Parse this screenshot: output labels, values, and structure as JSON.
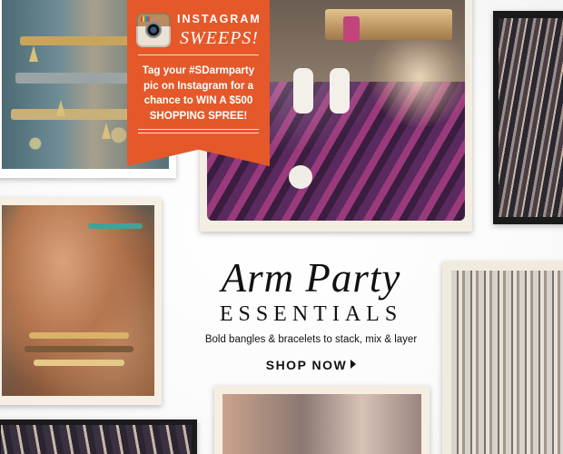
{
  "promo": {
    "brand": "INSTAGRAM",
    "headline": "SWEEPS!",
    "lines": [
      "Tag your #SDarmparty",
      "pic on Instagram for a",
      "chance to WIN A $500",
      "SHOPPING SPREE!"
    ],
    "color": "#e5582a"
  },
  "hero": {
    "title": "Arm Party",
    "subtitle": "ESSENTIALS",
    "tagline": "Bold bangles & bracelets to stack, mix & layer",
    "cta_label": "SHOP NOW"
  },
  "icons": {
    "brand_icon": "instagram-camera-icon",
    "cta_icon": "arrow-right-icon"
  }
}
